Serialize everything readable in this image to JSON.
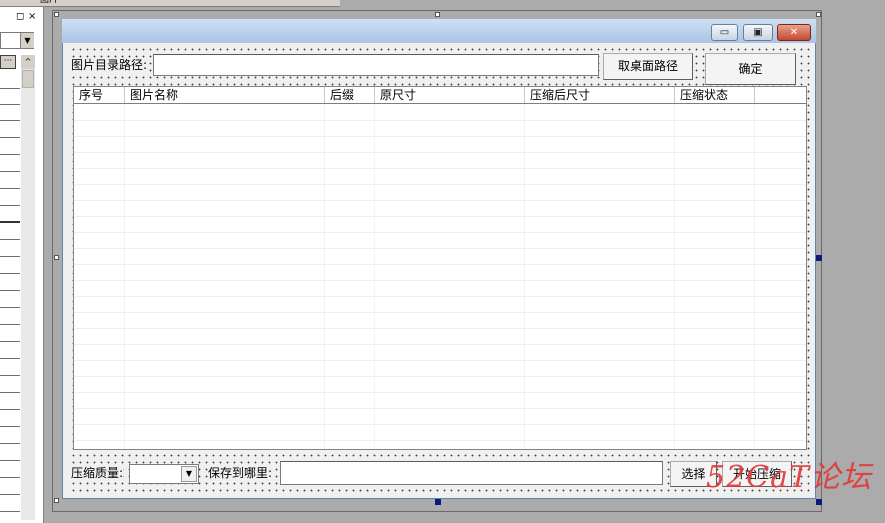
{
  "left_panel": {
    "top_tab_text": "图片",
    "max_glyph": "◻",
    "close_glyph": "×",
    "combo_arrow": "▼",
    "ellipsis": "···",
    "scroll_up": "^"
  },
  "form": {
    "title_buttons": {
      "minimize": "▭",
      "maximize": "▣",
      "close": "✕"
    },
    "path_label": "图片目录路径:",
    "path_value": "",
    "desktop_button": "取桌面路径",
    "ok_button": "确定",
    "list": {
      "columns": [
        "序号",
        "图片名称",
        "后缀",
        "原尺寸",
        "压缩后尺寸",
        "压缩状态"
      ],
      "rows": []
    },
    "quality_label": "压缩质量:",
    "quality_value": "",
    "quality_arrow": "▼",
    "save_label": "保存到哪里:",
    "save_value": "",
    "choose_button": "选择",
    "start_button": "开始压缩"
  },
  "watermark": "52CaT论坛",
  "colors": {
    "designer_bg": "#ababab",
    "form_bg": "#f0f0f0",
    "titlebar": "#b8d0ec",
    "close_button": "#c34a2e",
    "selection_handle": "#0a1a78",
    "watermark": "#e23a3a"
  }
}
